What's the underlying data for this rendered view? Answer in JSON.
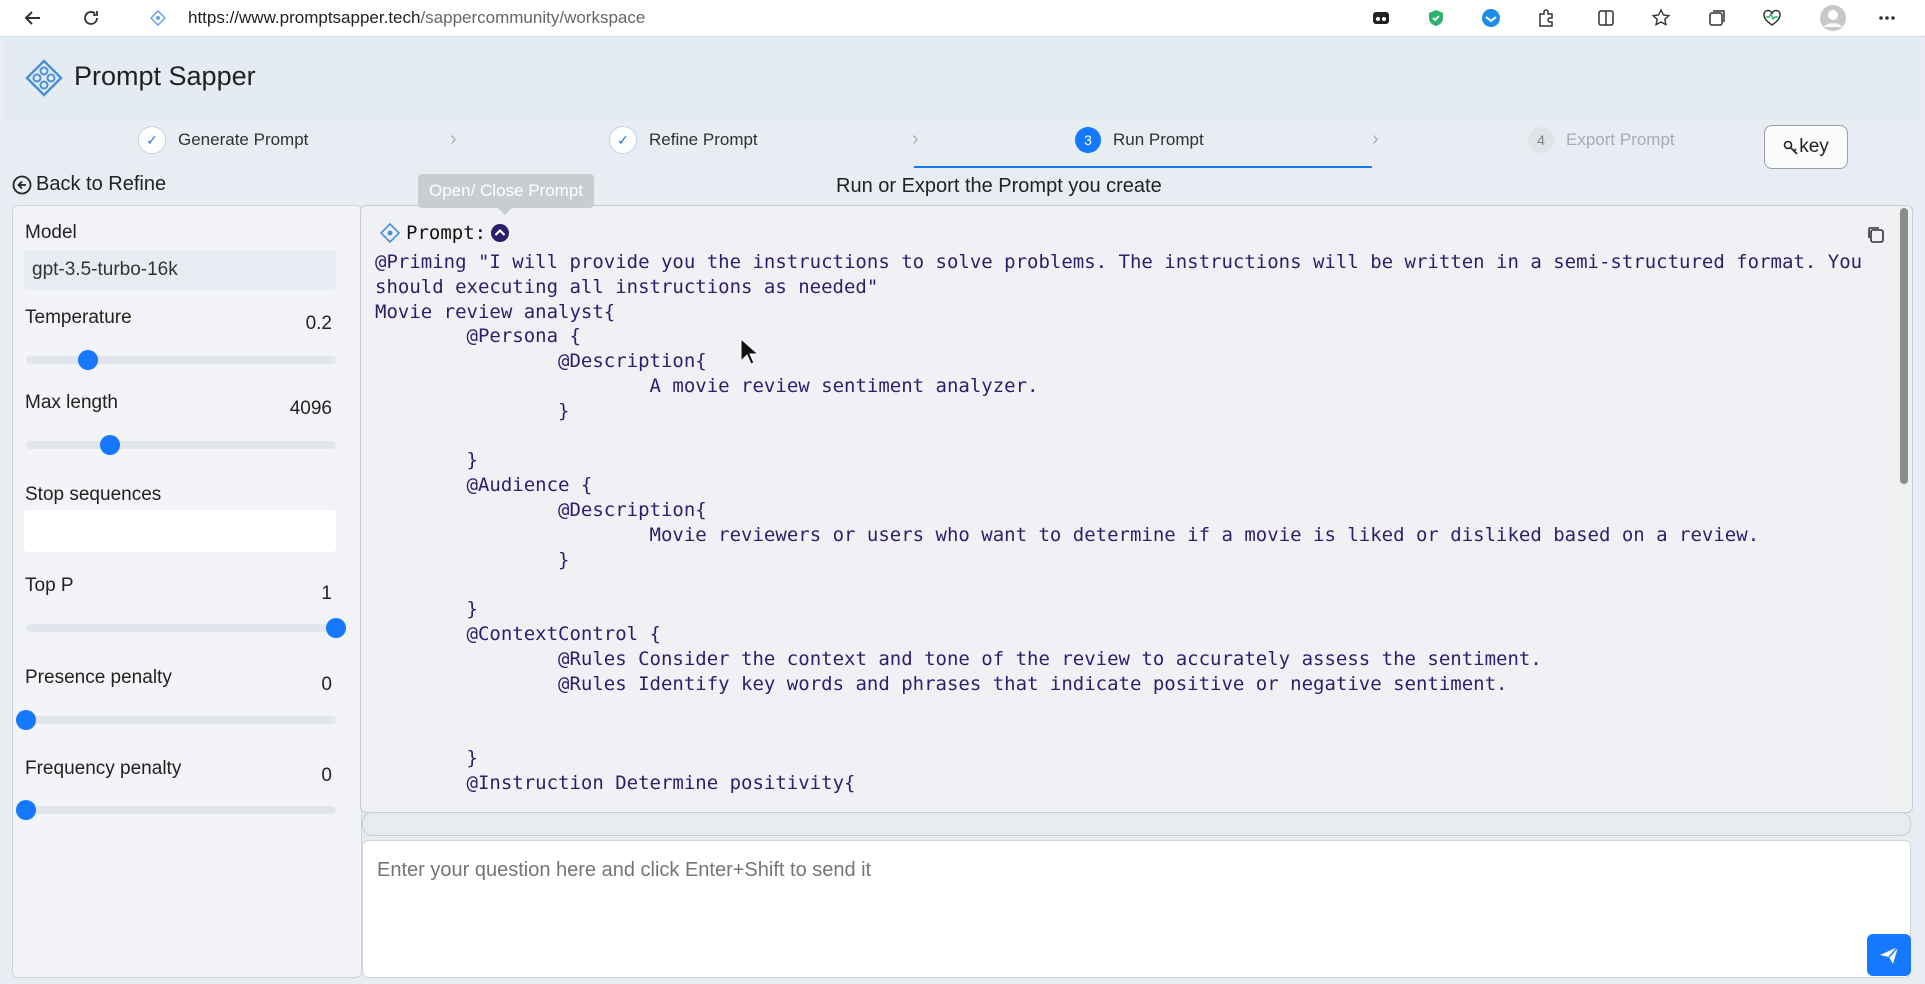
{
  "browser": {
    "url_host": "https://www.promptsapper.tech",
    "url_path": "/sappercommunity/workspace",
    "icons": [
      "back-icon",
      "refresh-icon",
      "site-icon",
      "tab-icon",
      "shield-icon",
      "vpn-icon",
      "extensions-icon",
      "split-screen-icon",
      "favorites-icon",
      "collections-icon",
      "health-icon",
      "profile-icon",
      "more-icon"
    ]
  },
  "app": {
    "title": "Prompt Sapper"
  },
  "steps": [
    {
      "label": "Generate Prompt",
      "state": "done",
      "marker": "✓"
    },
    {
      "label": "Refine Prompt",
      "state": "done",
      "marker": "✓"
    },
    {
      "label": "Run Prompt",
      "state": "current",
      "marker": "3"
    },
    {
      "label": "Export Prompt",
      "state": "todo",
      "marker": "4"
    }
  ],
  "key_button": "key",
  "back_label": "Back to Refine",
  "page_subtitle": "Run or Export the Prompt you create",
  "tooltip": "Open/ Close Prompt",
  "settings": {
    "model_label": "Model",
    "model_value": "gpt-3.5-turbo-16k",
    "temperature": {
      "label": "Temperature",
      "value": "0.2",
      "fraction": 0.2
    },
    "max_length": {
      "label": "Max length",
      "value": "4096",
      "fraction": 0.27
    },
    "stop_sequences": {
      "label": "Stop sequences",
      "value": ""
    },
    "top_p": {
      "label": "Top P",
      "value": "1",
      "fraction": 1.0
    },
    "presence_penalty": {
      "label": "Presence penalty",
      "value": "0",
      "fraction": 0.0
    },
    "frequency_penalty": {
      "label": "Frequency penalty",
      "value": "0",
      "fraction": 0.0
    }
  },
  "prompt": {
    "label": "Prompt:",
    "text": "@Priming \"I will provide you the instructions to solve problems. The instructions will be written in a semi-structured format. You should executing all instructions as needed\"\nMovie review analyst{\n\t@Persona {\n\t\t@Description{\n\t\t\tA movie review sentiment analyzer.\n\t\t}\n\n\t}\n\t@Audience {\n\t\t@Description{\n\t\t\tMovie reviewers or users who want to determine if a movie is liked or disliked based on a review.\n\t\t}\n\n\t}\n\t@ContextControl {\n\t\t@Rules Consider the context and tone of the review to accurately assess the sentiment.\n\t\t@Rules Identify key words and phrases that indicate positive or negative sentiment.\n\n\n\t}\n\t@Instruction Determine positivity{"
  },
  "question": {
    "placeholder": "Enter your question here and click Enter+Shift to send it"
  },
  "colors": {
    "accent": "#1677ff",
    "prompt_text": "#2b1f6b",
    "panel_bg": "#eff1f4"
  }
}
